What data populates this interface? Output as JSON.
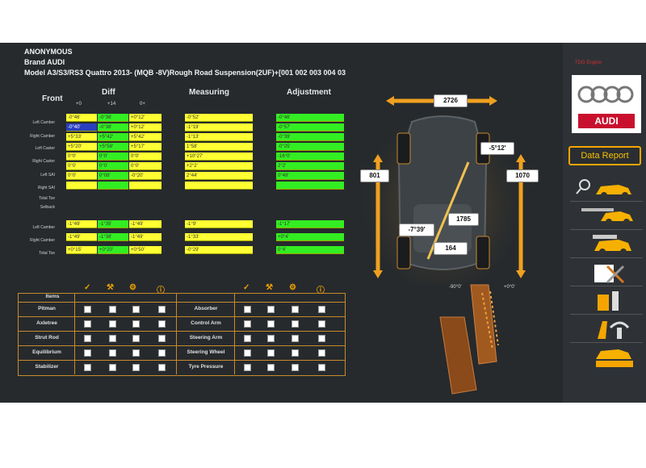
{
  "header": {
    "line1": "ANONYMOUS",
    "line2": "Brand AUDI",
    "line3": "Model A3/S3/RS3 Quattro 2013- (MQB -8V)Rough Road Suspension(2UF)+[001 002 003 004 03"
  },
  "columns": {
    "front": "Front",
    "diff": "Diff",
    "measuring": "Measuring",
    "adjustment": "Adjustment"
  },
  "diff_headers": [
    "+0",
    "+14",
    "0+"
  ],
  "front_rows": [
    {
      "label": "Left Camber",
      "diff": [
        "-0°46'",
        "-0°36'",
        "+0°12'"
      ]
    },
    {
      "label": "Right Camber",
      "diff": [
        "-0°40'",
        "-0°38'",
        "+0°12'"
      ]
    },
    {
      "label": "Left Caster",
      "diff": [
        "+5°33'",
        "+5°42'",
        "+5°42'"
      ]
    },
    {
      "label": "Right Caster",
      "diff": [
        "+5°20'",
        "+5°58'",
        "+5°17'"
      ]
    },
    {
      "label": "Left SAI",
      "diff": [
        "0°0'",
        "0°0'",
        "0°0'"
      ]
    },
    {
      "label": "Right SAI",
      "diff": [
        "0°0'",
        "0°0'",
        "0°0'"
      ]
    },
    {
      "label": "Total Toe",
      "diff": [
        "0°0'",
        "0°08'",
        "-0°20'"
      ]
    },
    {
      "label": "Setback",
      "diff": [
        "",
        "",
        ""
      ]
    }
  ],
  "measuring_front": [
    "-0°52'",
    "-1°19'",
    "-1°13'",
    "1°58'",
    "+10°27'",
    "+2°2'",
    "2°44'",
    ""
  ],
  "adjustment_front": [
    "-0°46'",
    "-0°57'",
    "-0°39'",
    "-0°25'",
    "-16°0'",
    "2°2'",
    "0°49'",
    ""
  ],
  "rear_rows": [
    {
      "label": "Left Camber",
      "diff": [
        "-1°49'",
        "-1°35'",
        "-1°49'"
      ]
    },
    {
      "label": "Right Camber",
      "diff": [
        "-1°49'",
        "-1°38'",
        "-1°49'"
      ]
    },
    {
      "label": "Total Toe",
      "diff": [
        "+0°15'",
        "+0°20'",
        "+0°50'"
      ]
    }
  ],
  "measuring_rear": [
    "-1°9'",
    "-1°33'",
    "-0°29'"
  ],
  "adjustment_rear": [
    "-1°17'",
    "+0°4'",
    "0°4'"
  ],
  "diagram_values": {
    "top": "2726",
    "right_upper": "-5°12'",
    "left_mid": "801",
    "right_mid": "1070",
    "center_lower": "1785",
    "left_lower": "-7°39'",
    "bottom": "164"
  },
  "checklist": {
    "header": "Items",
    "left_items": [
      "Pitman",
      "Axletree",
      "Strut Rod",
      "Equilibrium",
      "Stabilizer"
    ],
    "right_items": [
      "Absorber",
      "Control Arm",
      "Steering Arm",
      "Steering Wheel",
      "Tyre Pressure"
    ]
  },
  "pedal_labels": [
    "-90°0'",
    "+0°0'"
  ],
  "sidebar": {
    "brand_caption": "TDG Engine",
    "logo_text": "AUDI",
    "data_report": "Data Report",
    "tools": [
      "vehicle-search-icon",
      "car-lift-icon",
      "car-height-icon",
      "wrench-tools-icon",
      "steering-lock-icon",
      "brake-pedal-icon",
      "car-lift-up-icon"
    ]
  },
  "colors": {
    "accent": "#f6a500",
    "yellow_cell": "#ffff33",
    "green_cell": "#33ee22",
    "background": "#262a2d"
  }
}
